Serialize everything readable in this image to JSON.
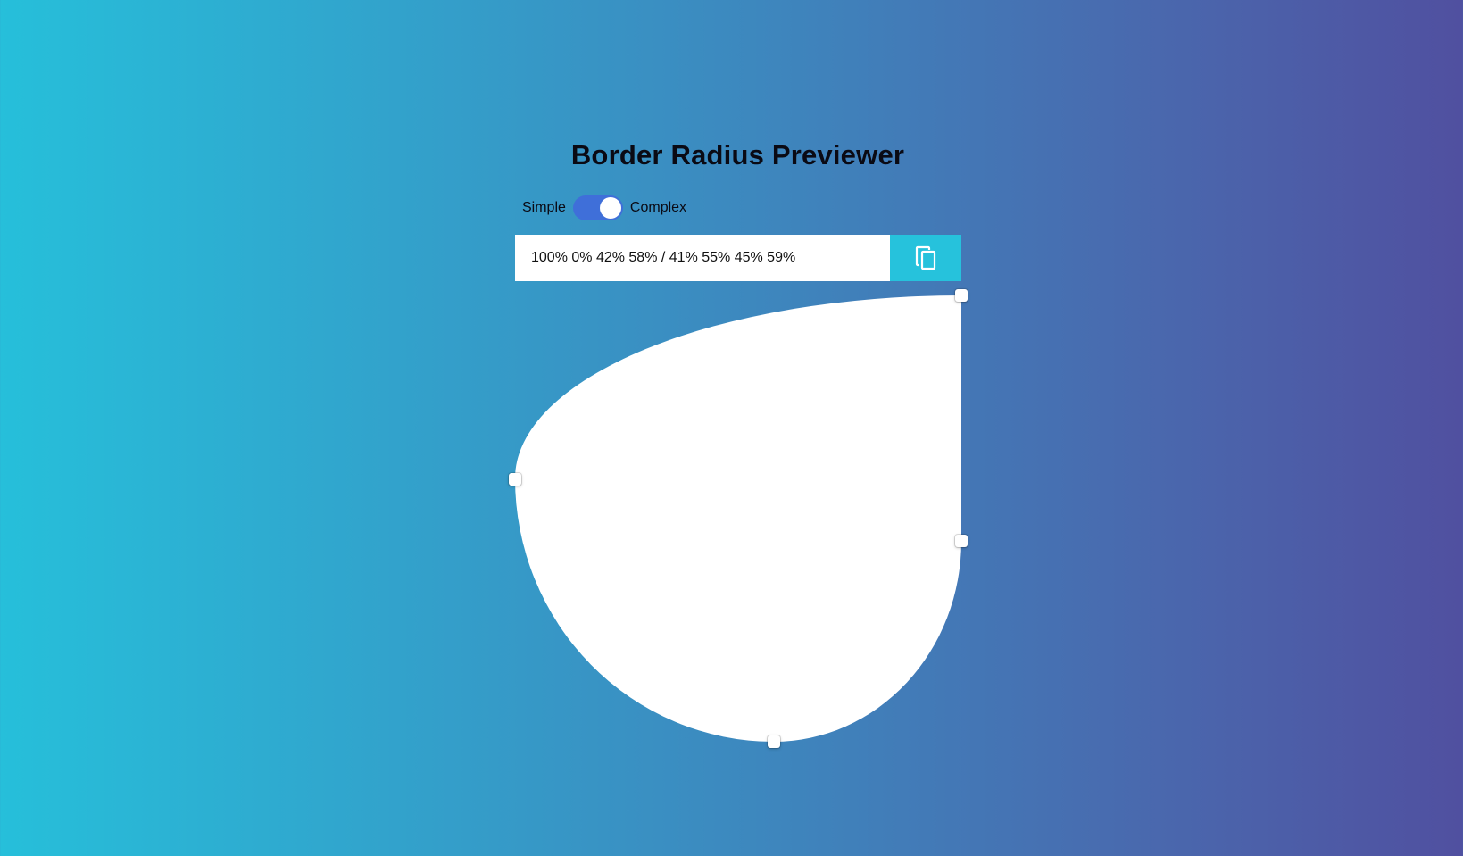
{
  "app": {
    "title": "Border Radius Previewer"
  },
  "mode_toggle": {
    "left_label": "Simple",
    "right_label": "Complex",
    "state": "Complex"
  },
  "radius_input": {
    "value": "100% 0% 42% 58% / 41% 55% 45% 59%"
  },
  "copy_button": {
    "icon": "copy-icon"
  },
  "colors": {
    "gradient_start": "#26bfda",
    "gradient_end": "#5050a0",
    "toggle_active": "#3f6fd9",
    "copy_button_bg": "#26c2dc",
    "shape": "#ffffff"
  }
}
